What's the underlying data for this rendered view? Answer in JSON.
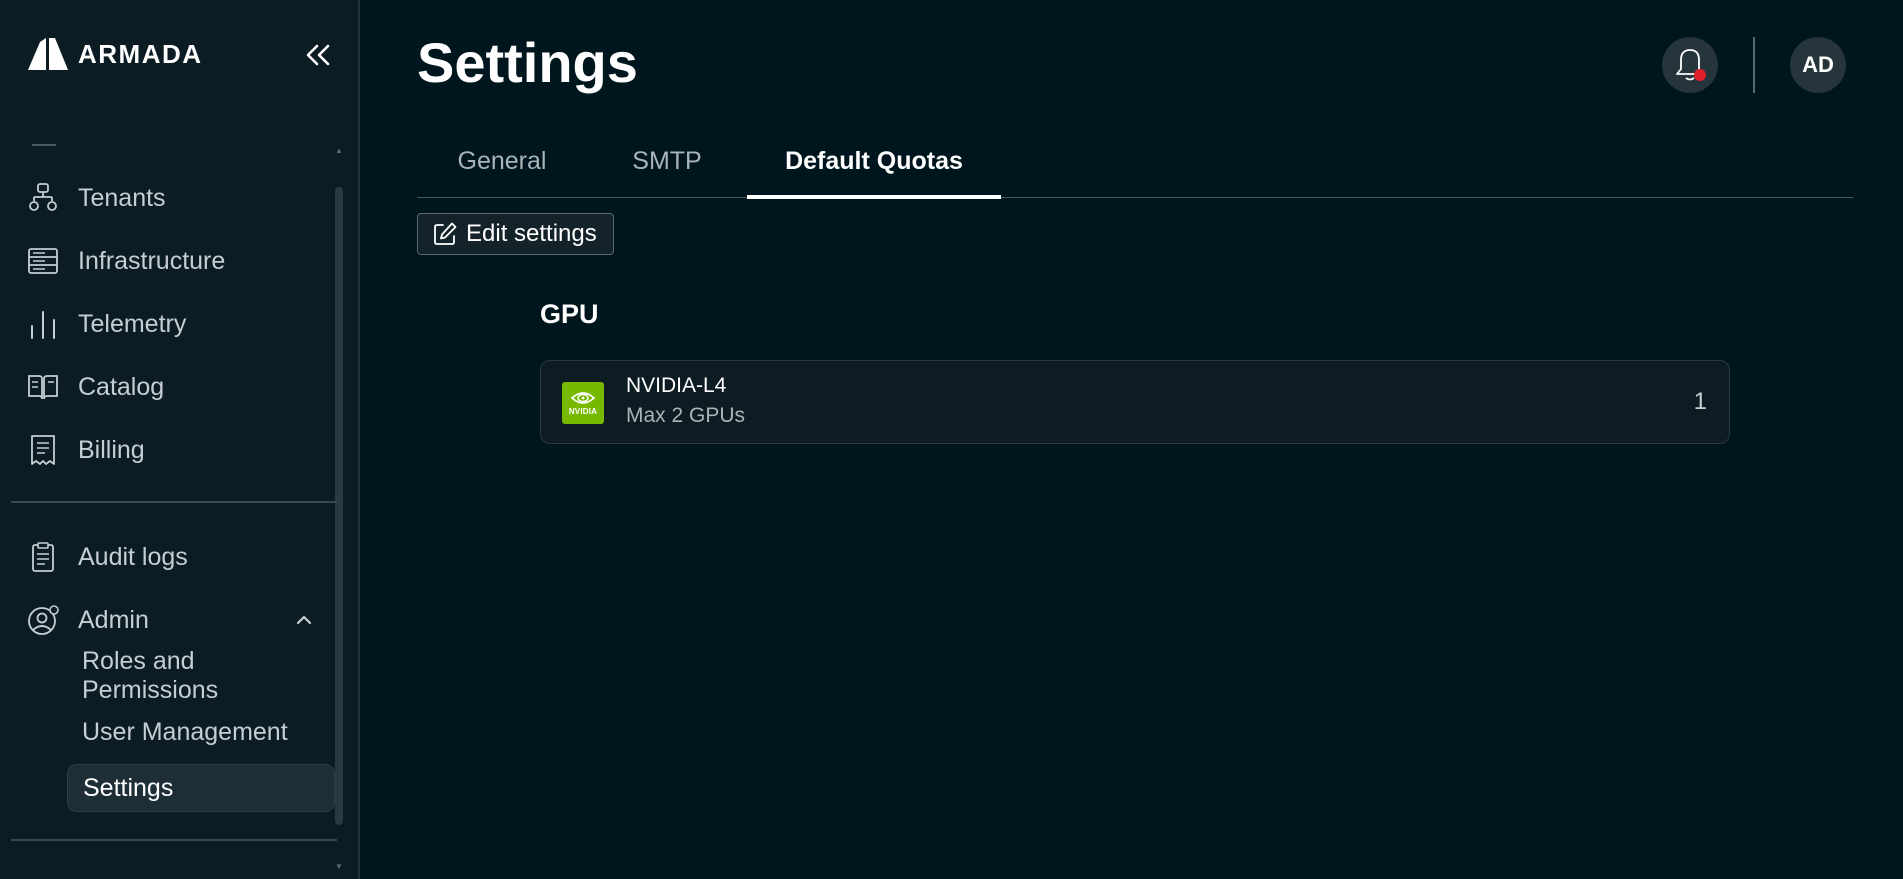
{
  "brand": {
    "name": "ARMADA"
  },
  "sidebar": {
    "items": [
      {
        "label": "Tenants",
        "icon": "tenants-icon"
      },
      {
        "label": "Infrastructure",
        "icon": "server-icon"
      },
      {
        "label": "Telemetry",
        "icon": "bar-chart-icon"
      },
      {
        "label": "Catalog",
        "icon": "book-icon"
      },
      {
        "label": "Billing",
        "icon": "receipt-icon"
      }
    ],
    "secondary": [
      {
        "label": "Audit logs",
        "icon": "clipboard-icon"
      },
      {
        "label": "Admin",
        "icon": "user-gear-icon",
        "expanded": true
      }
    ],
    "admin_sub": [
      {
        "label": "Roles and Permissions"
      },
      {
        "label": "User Management"
      },
      {
        "label": "Settings",
        "active": true
      }
    ]
  },
  "header": {
    "title": "Settings",
    "avatar_initials": "AD",
    "notification_unread": true
  },
  "tabs": [
    {
      "label": "General",
      "active": false
    },
    {
      "label": "SMTP",
      "active": false
    },
    {
      "label": "Default Quotas",
      "active": true
    }
  ],
  "toolbar": {
    "edit_label": "Edit settings"
  },
  "quotas": {
    "section_title": "GPU",
    "items": [
      {
        "name": "NVIDIA-L4",
        "max": "Max 2 GPUs",
        "value": "1",
        "logo_text": "NVIDIA",
        "logo_color": "#76b900"
      }
    ]
  },
  "colors": {
    "background": "#00161e",
    "sidebar": "#0c1c24",
    "accent": "#ffffff",
    "notification_dot": "#e0202a"
  }
}
